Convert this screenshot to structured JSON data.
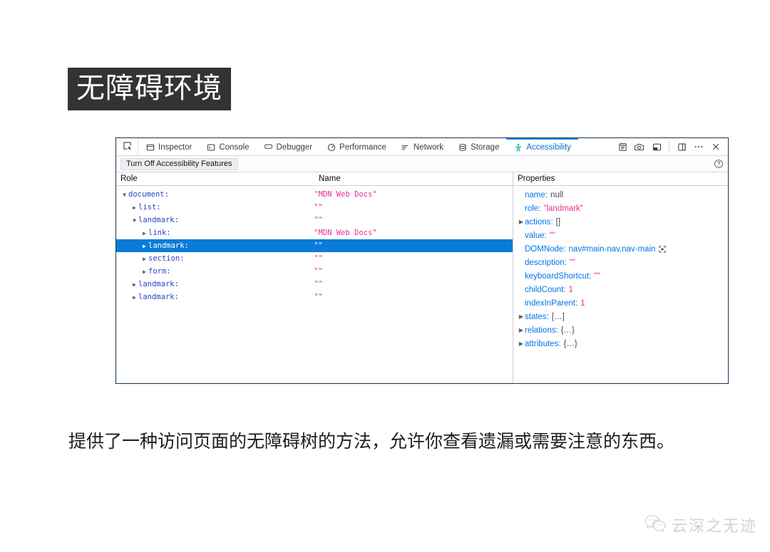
{
  "slide": {
    "title": "无障碍环境",
    "body_text": "提供了一种访问页面的无障碍树的方法，允许你查看遗漏或需要注意的东西。"
  },
  "colors": {
    "title_background": "#333333",
    "title_text": "#ffffff",
    "panel_border": "#1c3350",
    "tab_active": "#0a6bd4",
    "tab_active_border": "#0a84ff",
    "row_selected": "#0a7bd8",
    "role_text": "#2845c7",
    "name_text": "#e4308f",
    "prop_key": "#0074e8",
    "accessibility_icon": "#2ac3a2"
  },
  "devtools": {
    "picker_icon": "element-picker-icon",
    "tabs": [
      {
        "label": "Inspector",
        "icon": "inspector-icon",
        "active": false
      },
      {
        "label": "Console",
        "icon": "console-icon",
        "active": false
      },
      {
        "label": "Debugger",
        "icon": "debugger-icon",
        "active": false
      },
      {
        "label": "Performance",
        "icon": "performance-icon",
        "active": false
      },
      {
        "label": "Network",
        "icon": "network-icon",
        "active": false
      },
      {
        "label": "Storage",
        "icon": "storage-icon",
        "active": false
      },
      {
        "label": "Accessibility",
        "icon": "accessibility-icon",
        "active": true
      }
    ],
    "toolbar_icons": [
      "responsive-design-mode-icon",
      "camera-screenshot-icon",
      "split-console-icon",
      "dock-panel-icon",
      "meatball-menu-icon",
      "close-icon"
    ],
    "subtoolbar": {
      "toggle_label": "Turn Off Accessibility Features",
      "help_icon": "help-circle-icon"
    },
    "columns": {
      "role": "Role",
      "name": "Name",
      "properties": "Properties"
    },
    "tree": [
      {
        "role": "document:",
        "name": "\"MDN Web Docs\"",
        "depth": 0,
        "twisty": "expanded",
        "selected": false
      },
      {
        "role": "list:",
        "name": "\"\"",
        "depth": 1,
        "twisty": "collapsed",
        "selected": false
      },
      {
        "role": "landmark:",
        "name": "\"\"",
        "depth": 1,
        "twisty": "expanded",
        "selected": false
      },
      {
        "role": "link:",
        "name": "\"MDN Web Docs\"",
        "depth": 2,
        "twisty": "collapsed",
        "selected": false
      },
      {
        "role": "landmark:",
        "name": "\"\"",
        "depth": 2,
        "twisty": "collapsed",
        "selected": true
      },
      {
        "role": "section:",
        "name": "\"\"",
        "depth": 2,
        "twisty": "collapsed",
        "selected": false
      },
      {
        "role": "form:",
        "name": "\"\"",
        "depth": 2,
        "twisty": "collapsed",
        "selected": false
      },
      {
        "role": "landmark:",
        "name": "\"\"",
        "depth": 1,
        "twisty": "collapsed",
        "selected": false
      },
      {
        "role": "landmark:",
        "name": "\"\"",
        "depth": 1,
        "twisty": "collapsed",
        "selected": false
      }
    ],
    "properties": [
      {
        "key": "name",
        "value": "null",
        "kind": "null",
        "twisty": "none"
      },
      {
        "key": "role",
        "value": "\"landmark\"",
        "kind": "string",
        "twisty": "none"
      },
      {
        "key": "actions",
        "value": "[]",
        "kind": "plain",
        "twisty": "collapsed"
      },
      {
        "key": "value",
        "value": "\"\"",
        "kind": "string",
        "twisty": "none"
      },
      {
        "key": "DOMNode",
        "value": "nav#main-nav.nav-main",
        "kind": "node",
        "twisty": "none",
        "node_icon": "node-target-icon"
      },
      {
        "key": "description",
        "value": "\"\"",
        "kind": "string",
        "twisty": "none"
      },
      {
        "key": "keyboardShortcut",
        "value": "\"\"",
        "kind": "string",
        "twisty": "none"
      },
      {
        "key": "childCount",
        "value": "1",
        "kind": "num",
        "twisty": "none"
      },
      {
        "key": "indexInParent",
        "value": "1",
        "kind": "num",
        "twisty": "none"
      },
      {
        "key": "states",
        "value": "[…]",
        "kind": "plain",
        "twisty": "collapsed"
      },
      {
        "key": "relations",
        "value": "{…}",
        "kind": "plain",
        "twisty": "collapsed"
      },
      {
        "key": "attributes",
        "value": "{…}",
        "kind": "plain",
        "twisty": "collapsed"
      }
    ]
  },
  "watermark": {
    "icon": "wechat-icon",
    "text": "云深之无迹"
  }
}
